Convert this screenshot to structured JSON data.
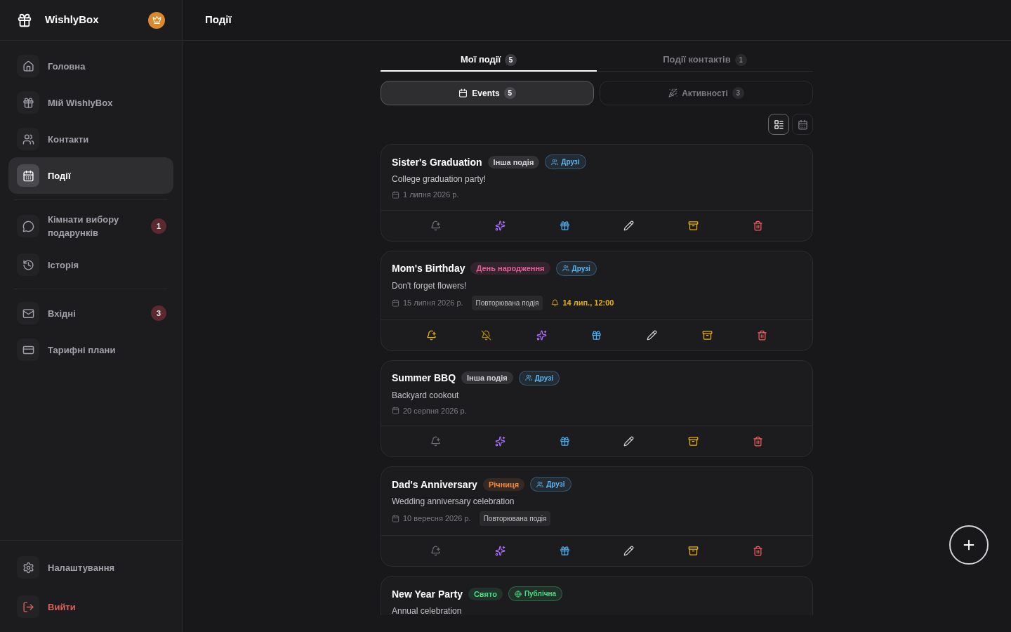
{
  "brand": {
    "name": "WishlyBox"
  },
  "sidebar": {
    "groups": [
      [
        {
          "kind": "home",
          "label": "Головна",
          "selected": false
        },
        {
          "kind": "gift",
          "label": "Мій WishlyBox",
          "selected": false
        },
        {
          "kind": "contacts",
          "label": "Контакти",
          "selected": false
        },
        {
          "kind": "events",
          "label": "Події",
          "selected": true
        }
      ],
      [
        {
          "kind": "rooms",
          "label": "Кімнати вибору подарунків",
          "selected": false,
          "badge": "1"
        },
        {
          "kind": "history",
          "label": "Історія",
          "selected": false
        }
      ],
      [
        {
          "kind": "inbox",
          "label": "Вхідні",
          "selected": false,
          "badge": "3"
        },
        {
          "kind": "plans",
          "label": "Тарифні плани",
          "selected": false
        }
      ]
    ],
    "footer": [
      {
        "kind": "settings",
        "label": "Налаштування"
      },
      {
        "kind": "logout",
        "label": "Вийти"
      }
    ]
  },
  "header": {
    "title": "Події"
  },
  "tabs": [
    {
      "label": "Мої події",
      "count": "5",
      "selected": true
    },
    {
      "label": "Події контактів",
      "count": "1",
      "selected": false
    }
  ],
  "segments": [
    {
      "kind": "events",
      "label": "Events",
      "count": "5",
      "selected": true
    },
    {
      "kind": "activities",
      "label": "Активності",
      "count": "3",
      "selected": false
    }
  ],
  "view_modes": [
    {
      "kind": "list",
      "selected": true
    },
    {
      "kind": "calendar",
      "selected": false
    }
  ],
  "events": [
    {
      "title": "Sister's Graduation",
      "category": {
        "label": "Інша подія",
        "color": "#d4d4d8"
      },
      "audience": {
        "kind": "friends",
        "label": "Друзі",
        "color": "#60b4f0"
      },
      "description": "College graduation party!",
      "date": "1 липня 2026 р."
    },
    {
      "title": "Mom's Birthday",
      "category": {
        "label": "День народження",
        "color": "#e0609a"
      },
      "audience": {
        "kind": "friends",
        "label": "Друзі",
        "color": "#60b4f0"
      },
      "description": "Don't forget flowers!",
      "date": "15 липня 2026 р.",
      "recurring": "Повторювана подія",
      "reminder": "14 лип., 12:00"
    },
    {
      "title": "Summer BBQ",
      "category": {
        "label": "Інша подія",
        "color": "#d4d4d8"
      },
      "audience": {
        "kind": "friends",
        "label": "Друзі",
        "color": "#60b4f0"
      },
      "description": "Backyard cookout",
      "date": "20 серпня 2026 р."
    },
    {
      "title": "Dad's Anniversary",
      "category": {
        "label": "Річниця",
        "color": "#f08a3c"
      },
      "audience": {
        "kind": "friends",
        "label": "Друзі",
        "color": "#60b4f0"
      },
      "description": "Wedding anniversary celebration",
      "date": "10 вересня 2026 р.",
      "recurring": "Повторювана подія"
    },
    {
      "title": "New Year Party",
      "category": {
        "label": "Свято",
        "color": "#4ade80"
      },
      "audience": {
        "kind": "public",
        "label": "Публічна",
        "color": "#4ade80"
      },
      "description": "Annual celebration"
    }
  ]
}
